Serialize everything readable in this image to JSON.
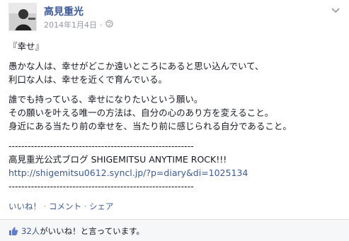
{
  "post": {
    "author": "高見重光",
    "date": "2014年1月4日",
    "separator": "·",
    "privacy_icon": "globe-icon",
    "menu_icon": "chevron-down-icon",
    "paragraphs": [
      [
        "『幸せ』"
      ],
      [
        "愚かな人は、幸せがどこか遠いところにあると思い込んでいて、",
        "利口な人は、幸せを近くで育んでいる。"
      ],
      [
        "誰でも持っている、幸せになりたいという願い。",
        "その願いを叶える唯一の方法は、自分の心のあり方を変えること。",
        "身近にある当たり前の幸せを、当たり前に感じられる自分であること。"
      ]
    ],
    "divider_top": "----------------------------------------------------------",
    "blog_title": "高見重光公式ブログ SHIGEMITSU ANYTIME ROCK!!!",
    "blog_url": "http://shigemitsu0612.syncl.jp/?p=diary&di=1025134",
    "divider_bottom": "----------------------------------------------------------"
  },
  "actions": {
    "like": "いいね！",
    "comment": "コメント",
    "share": "シェア",
    "separator": "·"
  },
  "likes": {
    "icon": "thumbs-up-icon",
    "count": "32人",
    "suffix": "がいいね！と言っています。"
  },
  "colors": {
    "link": "#3b5998",
    "meta": "#9197a3",
    "text": "#141823",
    "likes_bar_bg": "#f6f7f9"
  }
}
